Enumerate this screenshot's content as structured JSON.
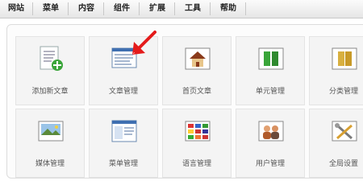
{
  "menu": [
    "网站",
    "菜单",
    "内容",
    "组件",
    "扩展",
    "工具",
    "帮助"
  ],
  "tiles": [
    {
      "label": "添加新文章",
      "icon": "add-article-icon"
    },
    {
      "label": "文章管理",
      "icon": "article-manager-icon"
    },
    {
      "label": "首页文章",
      "icon": "home-article-icon"
    },
    {
      "label": "单元管理",
      "icon": "section-manager-icon"
    },
    {
      "label": "分类管理",
      "icon": "category-manager-icon"
    },
    {
      "label": "媒体管理",
      "icon": "media-manager-icon"
    },
    {
      "label": "菜单管理",
      "icon": "menu-manager-icon"
    },
    {
      "label": "语言管理",
      "icon": "language-manager-icon"
    },
    {
      "label": "用户管理",
      "icon": "user-manager-icon"
    },
    {
      "label": "全局设置",
      "icon": "global-config-icon"
    }
  ],
  "annotation": {
    "icon": "red-arrow-icon",
    "color": "#e41b1b"
  }
}
